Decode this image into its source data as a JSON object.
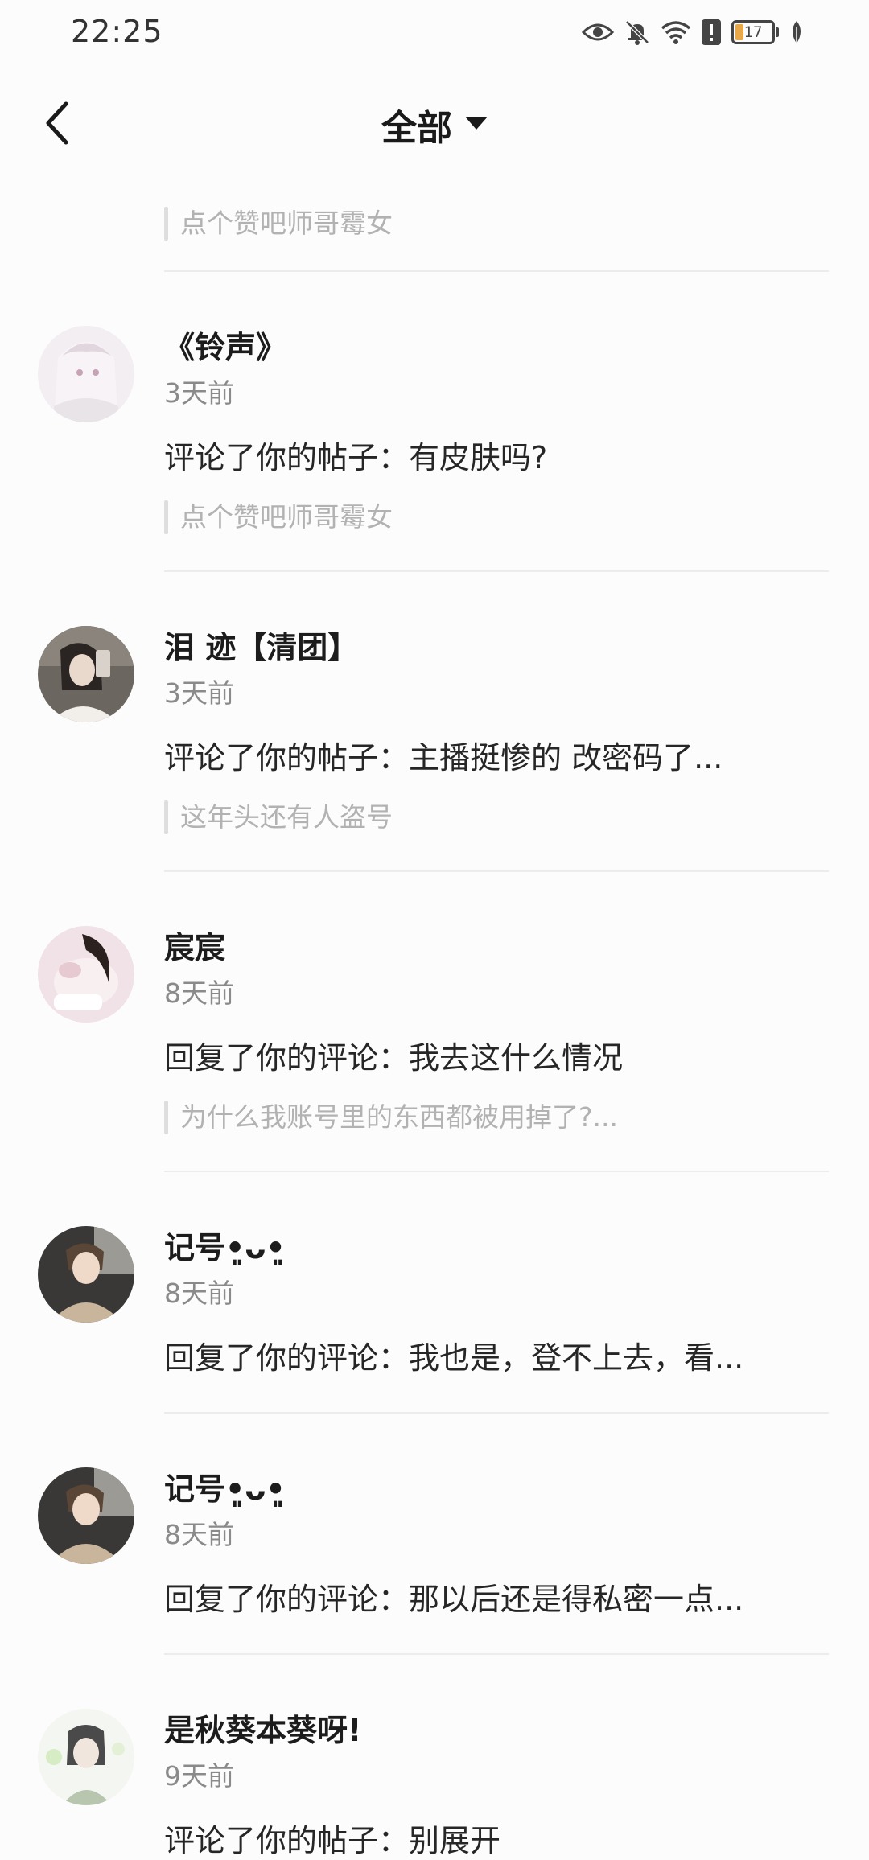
{
  "status_bar": {
    "time": "22:25",
    "battery_level": "17",
    "icons": [
      "eye-icon",
      "bell-off-icon",
      "wifi-icon",
      "alert-icon",
      "battery-icon",
      "leaf-icon"
    ]
  },
  "header": {
    "back_icon": "chevron-left-icon",
    "filter_title": "全部",
    "dropdown_icon": "caret-down-icon"
  },
  "partial_item": {
    "quote": "点个赞吧师哥霉女"
  },
  "notifications": [
    {
      "username": "《铃声》",
      "time": "3天前",
      "text": "评论了你的帖子：有皮肤吗?",
      "quote": "点个赞吧师哥霉女"
    },
    {
      "username": "泪 迹【清团】",
      "time": "3天前",
      "text": "评论了你的帖子：主播挺惨的 改密码了...",
      "quote": "这年头还有人盗号"
    },
    {
      "username": "宸宸",
      "time": "8天前",
      "text": "回复了你的评论：我去这什么情况",
      "quote": "为什么我账号里的东西都被用掉了?..."
    },
    {
      "username": "记号•͈ᴗ•͈",
      "time": "8天前",
      "text": "回复了你的评论：我也是，登不上去，看...",
      "quote": ""
    },
    {
      "username": "记号•͈ᴗ•͈",
      "time": "8天前",
      "text": "回复了你的评论：那以后还是得私密一点...",
      "quote": ""
    },
    {
      "username": "是秋葵本葵呀!",
      "time": "9天前",
      "text": "评论了你的帖子：别展开",
      "quote": ""
    }
  ],
  "colors": {
    "background": "#fdfcfd",
    "text_primary": "#1c1c1c",
    "text_secondary": "#8a8a8a",
    "quote_text": "#b2b2b2",
    "divider": "#ececec",
    "battery_fill": "#e8a84a"
  }
}
